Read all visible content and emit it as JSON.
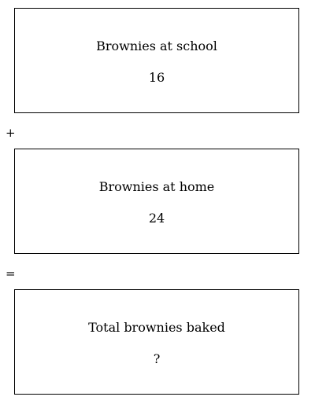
{
  "boxes": {
    "school": {
      "label": "Brownies at school",
      "value": "16"
    },
    "home": {
      "label": "Brownies at home",
      "value": "24"
    },
    "total": {
      "label": "Total brownies baked",
      "value": "?"
    }
  },
  "operators": {
    "plus": "+",
    "equals": "="
  }
}
